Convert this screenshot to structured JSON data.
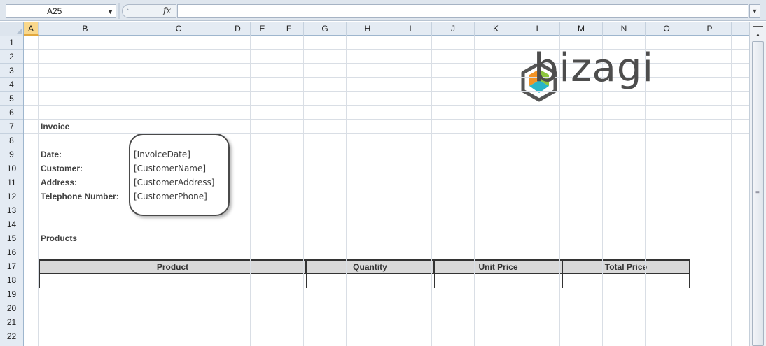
{
  "formula_bar": {
    "name_box": "A25",
    "fx_label": "fx",
    "formula": ""
  },
  "columns": [
    "A",
    "B",
    "C",
    "D",
    "E",
    "F",
    "G",
    "H",
    "I",
    "J",
    "K",
    "L",
    "M",
    "N",
    "O",
    "P"
  ],
  "selected_column": "A",
  "rows": [
    "1",
    "2",
    "3",
    "4",
    "5",
    "6",
    "7",
    "8",
    "9",
    "10",
    "11",
    "12",
    "13",
    "14",
    "15",
    "16",
    "17",
    "18",
    "19",
    "20",
    "21",
    "22"
  ],
  "sheet": {
    "invoice_title": "Invoice",
    "date_label": "Date:",
    "customer_label": "Customer:",
    "address_label": "Address:",
    "telephone_label": "Telephone Number:",
    "date_value": "[InvoiceDate]",
    "customer_value": "[CustomerName]",
    "address_value": "[CustomerAddress]",
    "phone_value": "[CustomerPhone]",
    "products_title": "Products"
  },
  "products_table": {
    "headers": [
      "Product",
      "Quantity",
      "Unit Price",
      "Total Price"
    ]
  },
  "logo": {
    "text": "bizagi",
    "colors": {
      "orange": "#f39325",
      "green": "#8cc63f",
      "teal": "#2ab5c9",
      "outline": "#555555"
    }
  }
}
